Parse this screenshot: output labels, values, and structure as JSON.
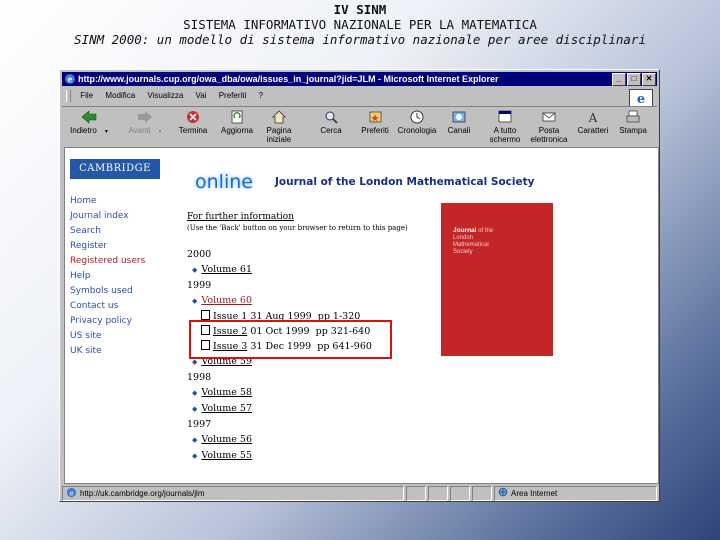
{
  "slide": {
    "title_line1": "IV SINM",
    "title_line2": "SISTEMA INFORMATIVO NAZIONALE PER LA MATEMATICA",
    "title_line3": "SINM 2000: un modello di sistema informativo nazionale per aree disciplinari"
  },
  "browser": {
    "window_title": "http://www.journals.cup.org/owa_dba/owa/issues_in_journal?jid=JLM - Microsoft Internet Explorer",
    "menu": [
      "File",
      "Modifica",
      "Visualizza",
      "Vai",
      "Preferiti",
      "?"
    ],
    "toolbar": [
      {
        "label": "Indietro",
        "icon": "back-arrow-icon",
        "enabled": true
      },
      {
        "label": "Avanti",
        "icon": "forward-arrow-icon",
        "enabled": false
      },
      {
        "label": "Termina",
        "icon": "stop-icon",
        "enabled": true
      },
      {
        "label": "Aggiorna",
        "icon": "refresh-icon",
        "enabled": true
      },
      {
        "label": "Pagina iniziale",
        "icon": "home-icon",
        "enabled": true
      },
      {
        "label": "Cerca",
        "icon": "search-icon",
        "enabled": true
      },
      {
        "label": "Preferiti",
        "icon": "favorites-icon",
        "enabled": true
      },
      {
        "label": "Cronologia",
        "icon": "history-icon",
        "enabled": true
      },
      {
        "label": "Canali",
        "icon": "channels-icon",
        "enabled": true
      },
      {
        "label": "A tutto schermo",
        "icon": "fullscreen-icon",
        "enabled": true
      },
      {
        "label": "Posta elettronica",
        "icon": "mail-icon",
        "enabled": true
      },
      {
        "label": "Caratteri",
        "icon": "fonts-icon",
        "enabled": true
      },
      {
        "label": "Stampa",
        "icon": "print-icon",
        "enabled": true
      }
    ],
    "status_url": "http://uk.cambridge.org/journals/jlm",
    "status_zone": "Area Internet"
  },
  "page": {
    "logo": "CAMBRIDGE",
    "nav": [
      "Home",
      "Journal index",
      "Search",
      "Register",
      "Registered users",
      "Help",
      "Symbols used",
      "Contact us",
      "Privacy policy",
      "US site",
      "UK site"
    ],
    "online_word": "online",
    "journal_title": "Journal of the London Mathematical Society",
    "further_info": "For further information",
    "further_note": "(Use the 'Back' button on your browser to return to this page)",
    "years": [
      {
        "year": "2000",
        "volumes": [
          {
            "label": "Volume 61"
          }
        ]
      },
      {
        "year": "1999",
        "volumes": [
          {
            "label": "Volume 60",
            "issues": [
              {
                "label": "Issue 1",
                "info": "31 Aug 1999  pp 1-320"
              },
              {
                "label": "Issue 2",
                "info": "01 Oct 1999  pp 321-640"
              },
              {
                "label": "Issue 3",
                "info": "31 Dec 1999  pp 641-960"
              }
            ]
          },
          {
            "label": "Volume 59"
          }
        ]
      },
      {
        "year": "1998",
        "volumes": [
          {
            "label": "Volume 58"
          },
          {
            "label": "Volume 57"
          }
        ]
      },
      {
        "year": "1997",
        "volumes": [
          {
            "label": "Volume 56"
          },
          {
            "label": "Volume 55"
          }
        ]
      }
    ],
    "cover": {
      "line1": "Journal",
      "line2": "of the",
      "line3": "London",
      "line4": "Mathematical",
      "line5": "Society"
    }
  },
  "colors": {
    "titlebar": "#00007b",
    "link": "#2c4fa6",
    "highlight": "#d61212",
    "cover": "#c42628"
  }
}
